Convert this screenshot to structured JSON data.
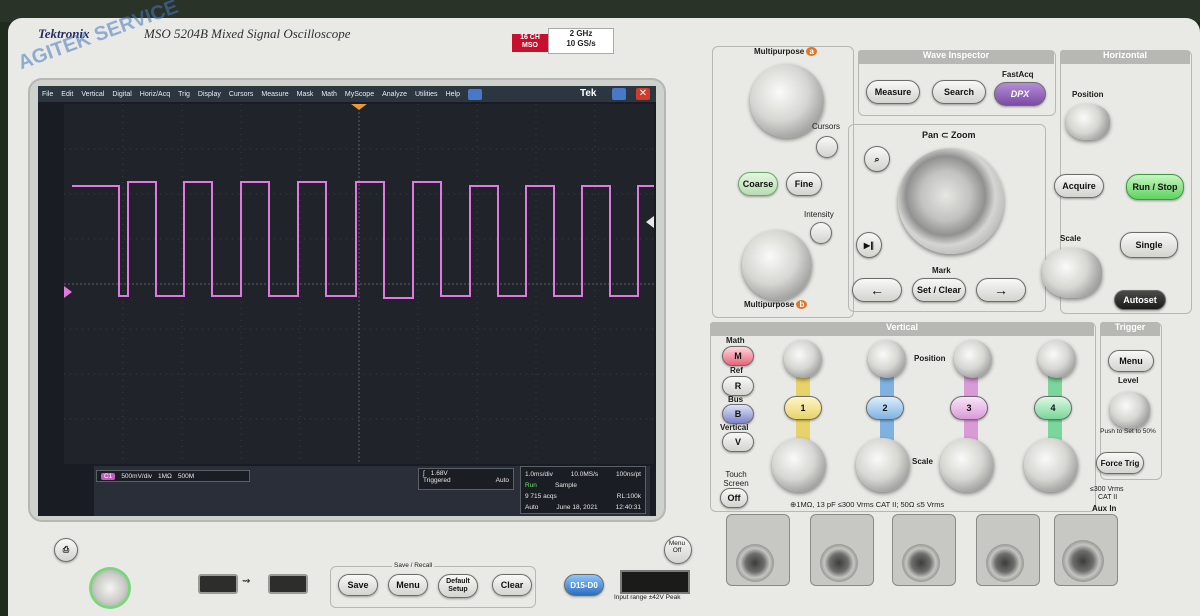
{
  "brand": {
    "name": "Tektronix",
    "model": "MSO 5204B Mixed Signal Oscilloscope",
    "badge_channels": "16 CH",
    "badge_type": "MSO",
    "bandwidth": "2 GHz",
    "sample_rate": "10 GS/s"
  },
  "watermark": "AGITEK SERVICE",
  "menu": [
    "File",
    "Edit",
    "Vertical",
    "Digital",
    "Horiz/Acq",
    "Trig",
    "Display",
    "Cursors",
    "Measure",
    "Mask",
    "Math",
    "MyScope",
    "Analyze",
    "Utilities",
    "Help"
  ],
  "screen_logo": "Tek",
  "status": {
    "ch_scale": "500mV/div",
    "ch_impedance": "1MΩ",
    "ch_bw": "500M",
    "trig_level": "1.68V",
    "trig_state": "Triggered",
    "trig_mode": "Auto",
    "time_div": "1.0ms/div",
    "srate": "10.0MS/s",
    "ns_pt": "100ns/pt",
    "run_state": "Run",
    "acq_mode": "Sample",
    "acqs": "9 715 acqs",
    "record_length": "RL:100k",
    "date_mode": "Auto",
    "date": "June 18, 2021",
    "time": "12:40:31"
  },
  "controls": {
    "multipurpose_a": "Multipurpose",
    "multipurpose_a_mark": "a",
    "multipurpose_b": "Multipurpose",
    "multipurpose_b_mark": "b",
    "cursors": "Cursors",
    "coarse": "Coarse",
    "fine": "Fine",
    "intensity": "Intensity",
    "wave_inspector": "Wave Inspector",
    "measure": "Measure",
    "search": "Search",
    "fastacq": "FastAcq",
    "dpx": "DPX",
    "pan_zoom": "Pan ⊂ Zoom",
    "mark": "Mark",
    "set_clear": "Set / Clear",
    "horizontal": "Horizontal",
    "position": "Position",
    "acquire": "Acquire",
    "run_stop": "Run / Stop",
    "scale": "Scale",
    "single": "Single",
    "autoset": "Autoset",
    "vertical": "Vertical",
    "math": "Math",
    "math_key": "M",
    "ref": "Ref",
    "ref_key": "R",
    "bus": "Bus",
    "bus_key": "B",
    "vertical_menu": "Vertical",
    "vertical_key": "V",
    "touch_screen": "Touch Screen",
    "off": "Off",
    "vpos": "Position",
    "vscale": "Scale",
    "ch1": "1",
    "ch2": "2",
    "ch3": "3",
    "ch4": "4",
    "input_spec": "⊕1MΩ, 13 pF ≤300 Vrms CAT II; 50Ω ≤5 Vrms",
    "trigger": "Trigger",
    "trig_menu": "Menu",
    "level": "Level",
    "push_50": "Push to Set to 50%",
    "force_trig": "Force Trig",
    "aux_spec_1": "≤300 Vrms",
    "aux_spec_2": "CAT II",
    "aux_in": "Aux In",
    "menu_off": "Menu Off",
    "save_recall": "Save / Recall",
    "save": "Save",
    "menu": "Menu",
    "default_setup": "Default Setup",
    "clear": "Clear",
    "digital_in": "D15-D0",
    "input_range": "Input range ±42V Peak"
  },
  "colors": {
    "ch1": "#e8d36a",
    "ch2": "#7fb2e0",
    "ch3": "#d99ad8",
    "ch4": "#7ad69a",
    "trace": "#e07ae0",
    "runstop": "#5fd35f"
  }
}
